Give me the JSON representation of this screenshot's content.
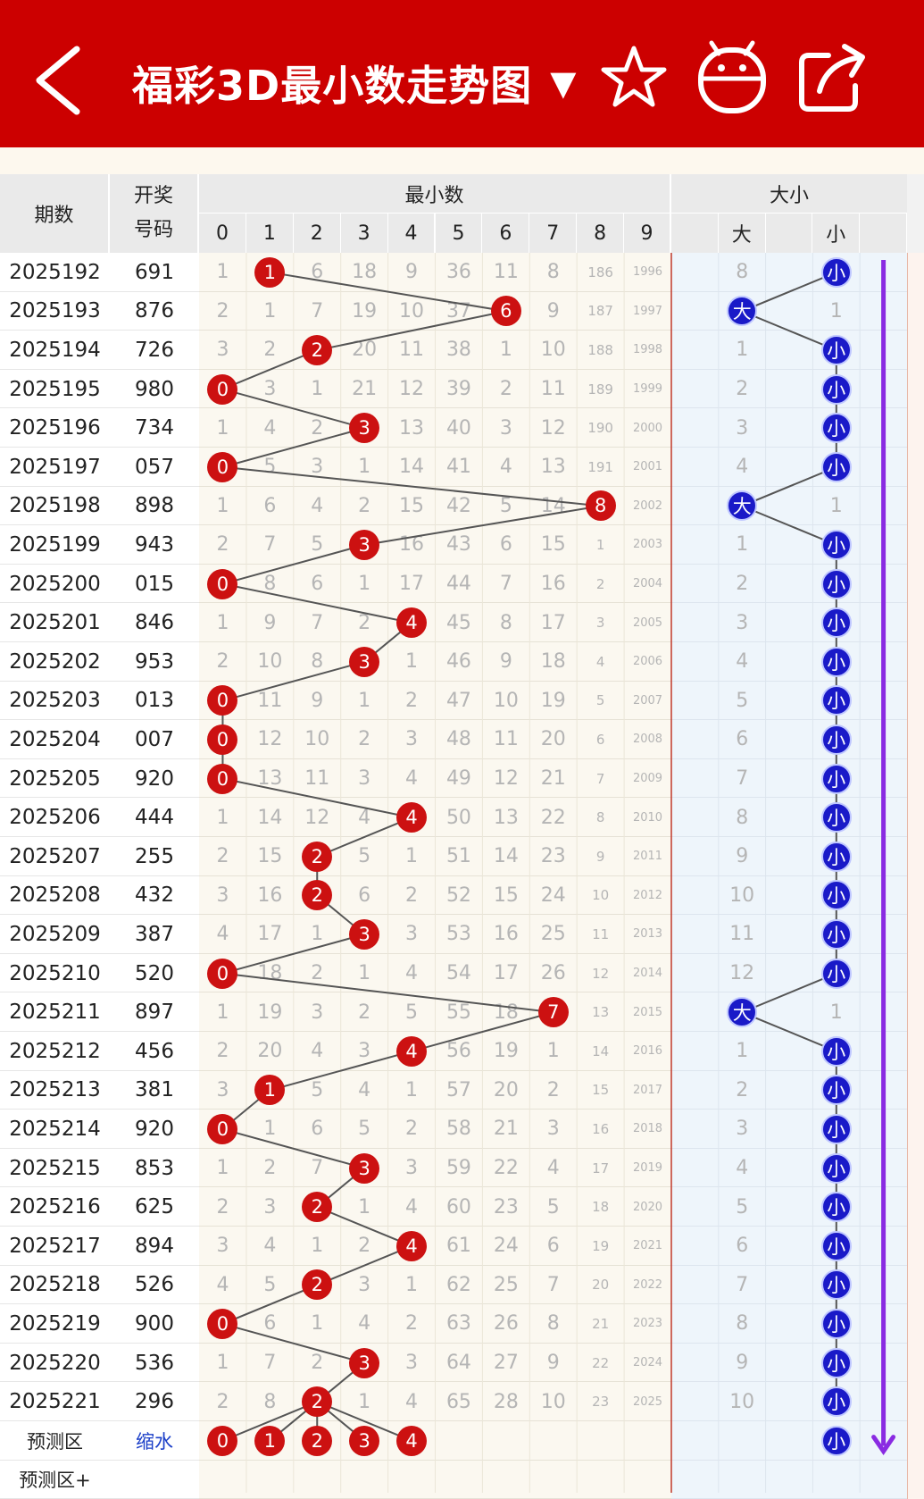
{
  "header": {
    "title": "福彩3D最小数走势图",
    "title_arrow": "▼",
    "back_icon": "chevron-left-icon",
    "favorite_icon": "star-icon",
    "robot_icon": "robot-icon",
    "share_icon": "share-icon"
  },
  "table": {
    "col_period": "期数",
    "col_draw_line1": "开奖",
    "col_draw_line2": "号码",
    "group_min": "最小数",
    "group_size": "大小",
    "digits": [
      "0",
      "1",
      "2",
      "3",
      "4",
      "5",
      "6",
      "7",
      "8",
      "9"
    ],
    "size_headers": [
      "",
      "大",
      "",
      "小",
      ""
    ],
    "rows": [
      {
        "period": "2025192",
        "draw": "691",
        "min": 1,
        "miss": [
          1,
          null,
          6,
          18,
          9,
          36,
          11,
          8,
          186,
          1996
        ],
        "size": "小",
        "big_miss": "8",
        "small_miss": null
      },
      {
        "period": "2025193",
        "draw": "876",
        "min": 6,
        "miss": [
          2,
          1,
          7,
          19,
          10,
          37,
          null,
          9,
          187,
          1997
        ],
        "size": "大",
        "big_miss": null,
        "small_miss": "1"
      },
      {
        "period": "2025194",
        "draw": "726",
        "min": 2,
        "miss": [
          3,
          2,
          null,
          20,
          11,
          38,
          1,
          10,
          188,
          1998
        ],
        "size": "小",
        "big_miss": "1",
        "small_miss": null
      },
      {
        "period": "2025195",
        "draw": "980",
        "min": 0,
        "miss": [
          null,
          3,
          1,
          21,
          12,
          39,
          2,
          11,
          189,
          1999
        ],
        "size": "小",
        "big_miss": "2",
        "small_miss": null
      },
      {
        "period": "2025196",
        "draw": "734",
        "min": 3,
        "miss": [
          1,
          4,
          2,
          null,
          13,
          40,
          3,
          12,
          190,
          2000
        ],
        "size": "小",
        "big_miss": "3",
        "small_miss": null
      },
      {
        "period": "2025197",
        "draw": "057",
        "min": 0,
        "miss": [
          null,
          5,
          3,
          1,
          14,
          41,
          4,
          13,
          191,
          2001
        ],
        "size": "小",
        "big_miss": "4",
        "small_miss": null
      },
      {
        "period": "2025198",
        "draw": "898",
        "min": 8,
        "miss": [
          1,
          6,
          4,
          2,
          15,
          42,
          5,
          14,
          null,
          2002
        ],
        "size": "大",
        "big_miss": null,
        "small_miss": "1"
      },
      {
        "period": "2025199",
        "draw": "943",
        "min": 3,
        "miss": [
          2,
          7,
          5,
          null,
          16,
          43,
          6,
          15,
          1,
          2003
        ],
        "size": "小",
        "big_miss": "1",
        "small_miss": null
      },
      {
        "period": "2025200",
        "draw": "015",
        "min": 0,
        "miss": [
          null,
          8,
          6,
          1,
          17,
          44,
          7,
          16,
          2,
          2004
        ],
        "size": "小",
        "big_miss": "2",
        "small_miss": null
      },
      {
        "period": "2025201",
        "draw": "846",
        "min": 4,
        "miss": [
          1,
          9,
          7,
          2,
          null,
          45,
          8,
          17,
          3,
          2005
        ],
        "size": "小",
        "big_miss": "3",
        "small_miss": null
      },
      {
        "period": "2025202",
        "draw": "953",
        "min": 3,
        "miss": [
          2,
          10,
          8,
          null,
          1,
          46,
          9,
          18,
          4,
          2006
        ],
        "size": "小",
        "big_miss": "4",
        "small_miss": null
      },
      {
        "period": "2025203",
        "draw": "013",
        "min": 0,
        "miss": [
          null,
          11,
          9,
          1,
          2,
          47,
          10,
          19,
          5,
          2007
        ],
        "size": "小",
        "big_miss": "5",
        "small_miss": null
      },
      {
        "period": "2025204",
        "draw": "007",
        "min": 0,
        "miss": [
          null,
          12,
          10,
          2,
          3,
          48,
          11,
          20,
          6,
          2008
        ],
        "size": "小",
        "big_miss": "6",
        "small_miss": null
      },
      {
        "period": "2025205",
        "draw": "920",
        "min": 0,
        "miss": [
          null,
          13,
          11,
          3,
          4,
          49,
          12,
          21,
          7,
          2009
        ],
        "size": "小",
        "big_miss": "7",
        "small_miss": null
      },
      {
        "period": "2025206",
        "draw": "444",
        "min": 4,
        "miss": [
          1,
          14,
          12,
          4,
          null,
          50,
          13,
          22,
          8,
          2010
        ],
        "size": "小",
        "big_miss": "8",
        "small_miss": null
      },
      {
        "period": "2025207",
        "draw": "255",
        "min": 2,
        "miss": [
          2,
          15,
          null,
          5,
          1,
          51,
          14,
          23,
          9,
          2011
        ],
        "size": "小",
        "big_miss": "9",
        "small_miss": null
      },
      {
        "period": "2025208",
        "draw": "432",
        "min": 2,
        "miss": [
          3,
          16,
          null,
          6,
          2,
          52,
          15,
          24,
          10,
          2012
        ],
        "size": "小",
        "big_miss": "10",
        "small_miss": null
      },
      {
        "period": "2025209",
        "draw": "387",
        "min": 3,
        "miss": [
          4,
          17,
          1,
          null,
          3,
          53,
          16,
          25,
          11,
          2013
        ],
        "size": "小",
        "big_miss": "11",
        "small_miss": null
      },
      {
        "period": "2025210",
        "draw": "520",
        "min": 0,
        "miss": [
          null,
          18,
          2,
          1,
          4,
          54,
          17,
          26,
          12,
          2014
        ],
        "size": "小",
        "big_miss": "12",
        "small_miss": null
      },
      {
        "period": "2025211",
        "draw": "897",
        "min": 7,
        "miss": [
          1,
          19,
          3,
          2,
          5,
          55,
          18,
          null,
          13,
          2015
        ],
        "size": "大",
        "big_miss": null,
        "small_miss": "1"
      },
      {
        "period": "2025212",
        "draw": "456",
        "min": 4,
        "miss": [
          2,
          20,
          4,
          3,
          null,
          56,
          19,
          1,
          14,
          2016
        ],
        "size": "小",
        "big_miss": "1",
        "small_miss": null
      },
      {
        "period": "2025213",
        "draw": "381",
        "min": 1,
        "miss": [
          3,
          null,
          5,
          4,
          1,
          57,
          20,
          2,
          15,
          2017
        ],
        "size": "小",
        "big_miss": "2",
        "small_miss": null
      },
      {
        "period": "2025214",
        "draw": "920",
        "min": 0,
        "miss": [
          null,
          1,
          6,
          5,
          2,
          58,
          21,
          3,
          16,
          2018
        ],
        "size": "小",
        "big_miss": "3",
        "small_miss": null
      },
      {
        "period": "2025215",
        "draw": "853",
        "min": 3,
        "miss": [
          1,
          2,
          7,
          null,
          3,
          59,
          22,
          4,
          17,
          2019
        ],
        "size": "小",
        "big_miss": "4",
        "small_miss": null
      },
      {
        "period": "2025216",
        "draw": "625",
        "min": 2,
        "miss": [
          2,
          3,
          null,
          1,
          4,
          60,
          23,
          5,
          18,
          2020
        ],
        "size": "小",
        "big_miss": "5",
        "small_miss": null
      },
      {
        "period": "2025217",
        "draw": "894",
        "min": 4,
        "miss": [
          3,
          4,
          1,
          2,
          null,
          61,
          24,
          6,
          19,
          2021
        ],
        "size": "小",
        "big_miss": "6",
        "small_miss": null
      },
      {
        "period": "2025218",
        "draw": "526",
        "min": 2,
        "miss": [
          4,
          5,
          null,
          3,
          1,
          62,
          25,
          7,
          20,
          2022
        ],
        "size": "小",
        "big_miss": "7",
        "small_miss": null
      },
      {
        "period": "2025219",
        "draw": "900",
        "min": 0,
        "miss": [
          null,
          6,
          1,
          4,
          2,
          63,
          26,
          8,
          21,
          2023
        ],
        "size": "小",
        "big_miss": "8",
        "small_miss": null
      },
      {
        "period": "2025220",
        "draw": "536",
        "min": 3,
        "miss": [
          1,
          7,
          2,
          null,
          3,
          64,
          27,
          9,
          22,
          2024
        ],
        "size": "小",
        "big_miss": "9",
        "small_miss": null
      },
      {
        "period": "2025221",
        "draw": "296",
        "min": 2,
        "miss": [
          2,
          8,
          null,
          1,
          4,
          65,
          28,
          10,
          23,
          2025
        ],
        "size": "小",
        "big_miss": "10",
        "small_miss": null
      }
    ],
    "prediction": {
      "label": "预测区",
      "link": "缩水",
      "balls": [
        0,
        1,
        2,
        3,
        4
      ],
      "size_ball": "小"
    },
    "prediction_plus": {
      "label": "预测区+"
    }
  },
  "colors": {
    "brand_red": "#cc0000",
    "ball_red": "#cc1111",
    "ball_blue": "#1a1ac8",
    "line_color": "#555555",
    "arrow_purple": "#8a2be2"
  }
}
